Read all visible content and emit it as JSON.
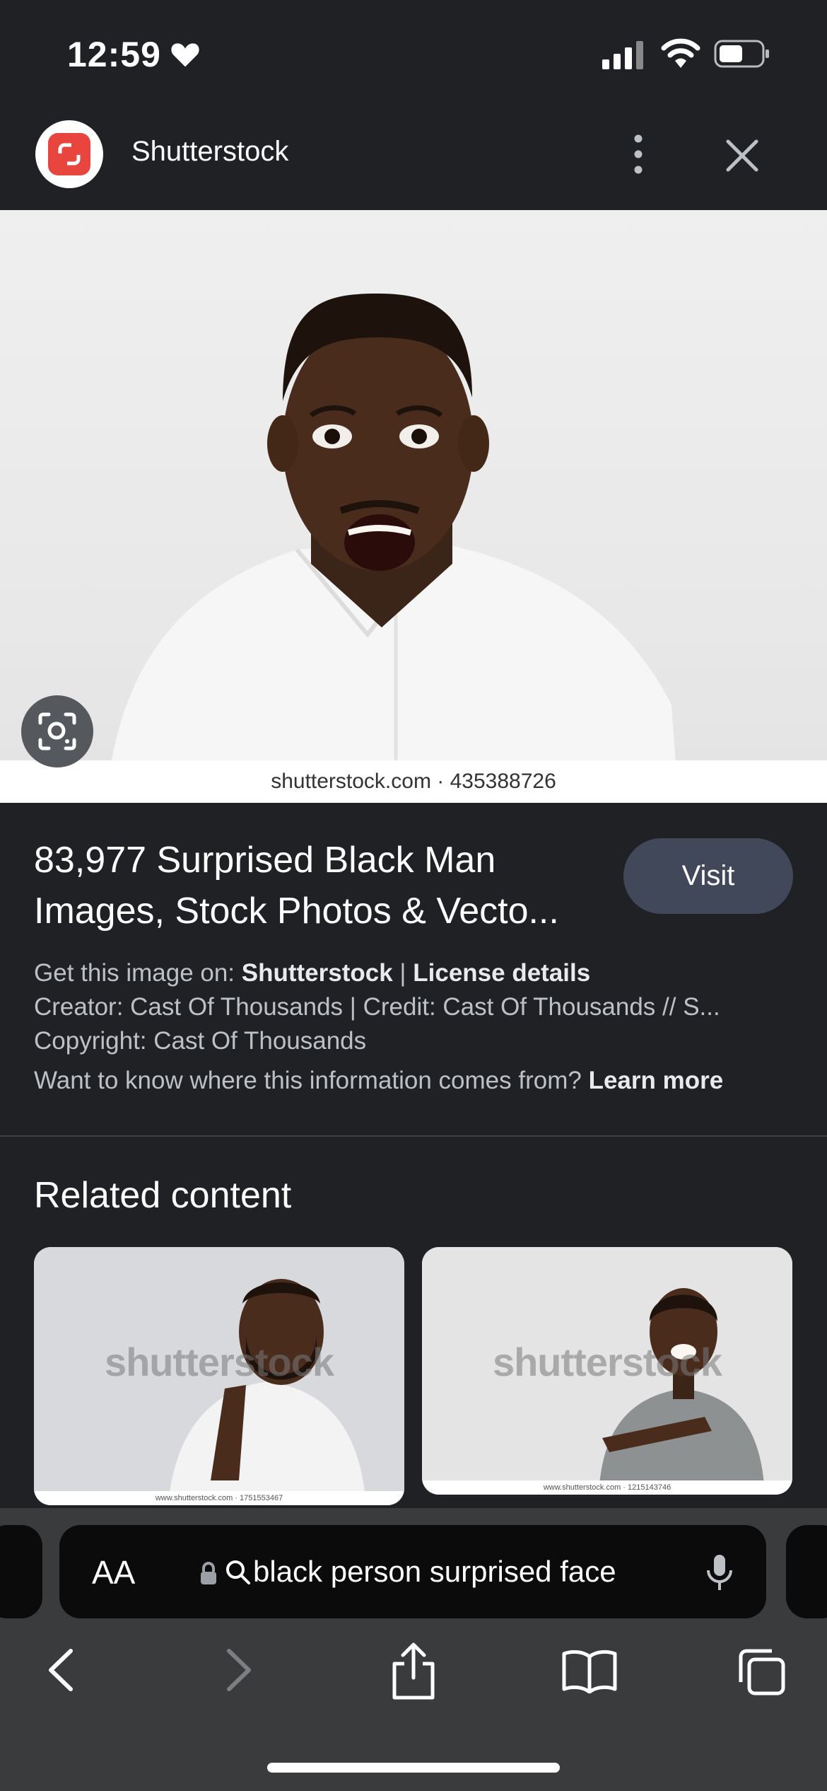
{
  "status_bar": {
    "time": "12:59"
  },
  "header": {
    "site_name": "Shutterstock"
  },
  "image": {
    "caption": "shutterstock.com · 435388726"
  },
  "result": {
    "title": "83,977 Surprised Black Man Images, Stock Photos & Vecto...",
    "visit_label": "Visit",
    "get_image_prefix": "Get this image on: ",
    "get_image_source": "Shutterstock",
    "separator": " | ",
    "license_label": "License details",
    "creator_line": "Creator: Cast Of Thousands | Credit: Cast Of Thousands // S...",
    "copyright_line": "Copyright: Cast Of Thousands",
    "learn_prefix": "Want to know where this information comes from? ",
    "learn_more": "Learn more"
  },
  "related": {
    "heading": "Related content",
    "items": [
      {
        "watermark": "shutterstock",
        "caption": "www.shutterstock.com · 1751553467"
      },
      {
        "watermark": "shutterstock",
        "caption": "www.shutterstock.com · 1215143746"
      }
    ]
  },
  "browser": {
    "text_size_label": "AA",
    "url_text": "black person surprised face"
  },
  "colors": {
    "accent": "#e8453f",
    "background": "#202124",
    "visit_button": "#404859"
  }
}
